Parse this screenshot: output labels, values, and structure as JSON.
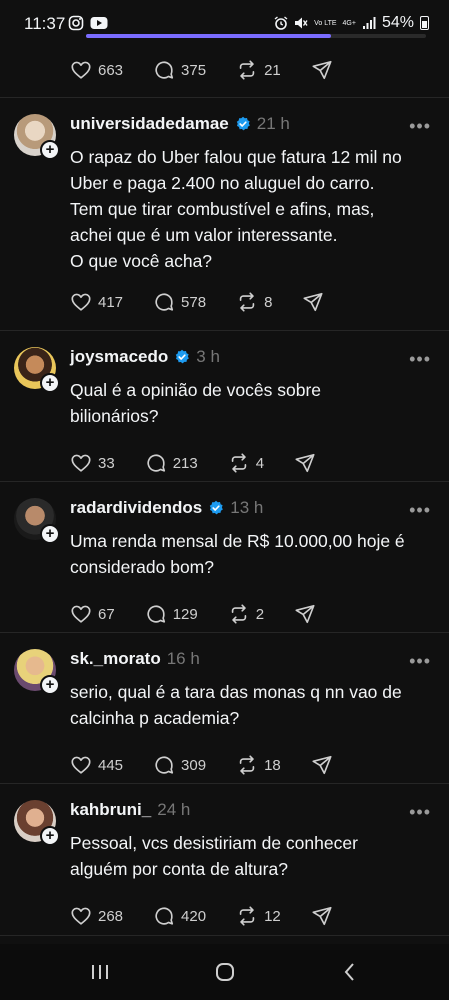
{
  "status": {
    "time": "11:37",
    "network": "4G+",
    "volte": "Vo LTE",
    "battery": "54%"
  },
  "top_post": {
    "progress": 0.72,
    "likes": "663",
    "replies": "375",
    "reposts": "21"
  },
  "posts": [
    {
      "username": "universidadedamae",
      "verified": true,
      "time": "21 h",
      "text": "O rapaz do Uber falou que fatura 12 mil no\nUber e paga 2.400 no aluguel do carro.\nTem que tirar combustível e afins, mas,\nachei que é um valor interessante.\nO que você acha?",
      "likes": "417",
      "replies": "578",
      "reposts": "8"
    },
    {
      "username": "joysmacedo",
      "verified": true,
      "time": "3 h",
      "text": "Qual é a opinião de vocês sobre\nbilionários?",
      "likes": "33",
      "replies": "213",
      "reposts": "4"
    },
    {
      "username": "radardividendos",
      "verified": true,
      "time": "13 h",
      "text": "Uma renda mensal de  R$ 10.000,00 hoje é\nconsiderado bom?",
      "likes": "67",
      "replies": "129",
      "reposts": "2"
    },
    {
      "username": "sk._morato",
      "verified": false,
      "time": "16 h",
      "text": "serio, qual é a tara das monas q nn vao de\ncalcinha p academia?",
      "likes": "445",
      "replies": "309",
      "reposts": "18"
    },
    {
      "username": "kahbruni_",
      "verified": false,
      "time": "24 h",
      "text": "Pessoal, vcs desistiriam de conhecer\nalguém por conta de altura?",
      "likes": "268",
      "replies": "420",
      "reposts": "12"
    }
  ],
  "icons": {
    "like": "heart-icon",
    "reply": "comment-icon",
    "repost": "repost-icon",
    "share": "send-icon",
    "more": "more-icon",
    "follow": "plus-icon",
    "nav_recents": "recents-icon",
    "nav_home": "home-icon",
    "nav_back": "back-icon"
  },
  "colors": {
    "background": "#101010",
    "text": "#f3f5f7",
    "muted": "#777777",
    "verified": "#1d9bf0",
    "accent": "#7a6cff"
  }
}
